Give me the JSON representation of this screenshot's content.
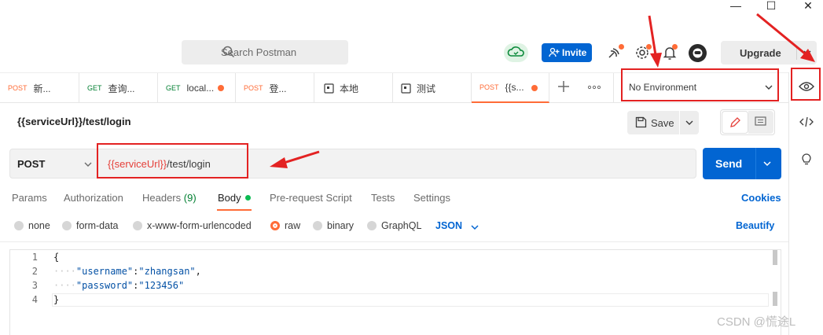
{
  "window_controls": {
    "minimize": "—",
    "maximize": "☐",
    "close": "✕"
  },
  "header": {
    "search_placeholder": "Search Postman",
    "invite_label": "Invite",
    "upgrade_label": "Upgrade",
    "accent_color": "#ff6c37",
    "primary_color": "#0265d2"
  },
  "tabs": [
    {
      "method": "POST",
      "label": "新..."
    },
    {
      "method": "GET",
      "label": "查询..."
    },
    {
      "method": "GET",
      "label": "local..."
    },
    {
      "method": "POST",
      "label": "登..."
    },
    {
      "method": "",
      "label": "本地"
    },
    {
      "method": "",
      "label": "测试"
    },
    {
      "method": "POST",
      "label": "{{s..."
    }
  ],
  "environment": {
    "selected": "No Environment"
  },
  "request": {
    "title": "{{serviceUrl}}/test/login",
    "save_label": "Save",
    "method": "POST",
    "url_variable": "{{serviceUrl}}",
    "url_path": "/test/login",
    "send_label": "Send"
  },
  "request_tabs": {
    "params": "Params",
    "authorization": "Authorization",
    "headers": "Headers",
    "headers_count": "(9)",
    "body": "Body",
    "prerequest": "Pre-request Script",
    "tests": "Tests",
    "settings": "Settings",
    "cookies": "Cookies"
  },
  "body_types": {
    "none": "none",
    "form_data": "form-data",
    "urlencoded": "x-www-form-urlencoded",
    "raw": "raw",
    "binary": "binary",
    "graphql": "GraphQL",
    "format": "JSON",
    "beautify": "Beautify",
    "selected": "raw"
  },
  "editor": {
    "line_numbers": [
      "1",
      "2",
      "3",
      "4"
    ],
    "line1": "{",
    "line2_indent": "····",
    "line2_key": "\"username\"",
    "line2_colon": ":",
    "line2_value": "\"zhangsan\"",
    "line2_comma": ",",
    "line3_indent": "····",
    "line3_key": "\"password\"",
    "line3_colon": ":",
    "line3_value": "\"123456\"",
    "line4": "}"
  },
  "watermark": "CSDN @慌途L"
}
